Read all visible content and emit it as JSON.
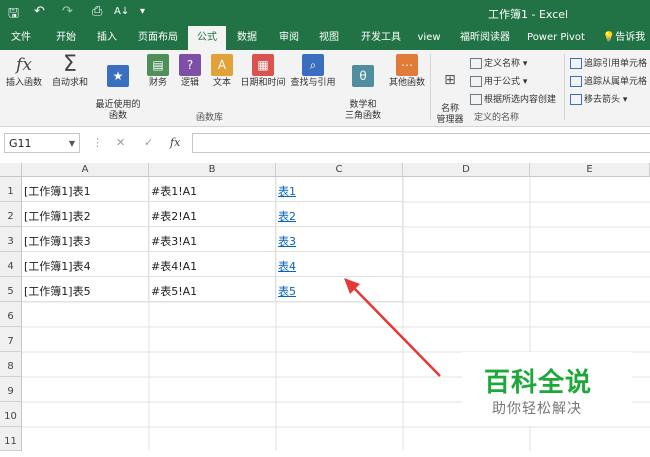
{
  "quick_access": {
    "save": "🖫",
    "undo": "↶",
    "redo": "↷",
    "print_preview": "⎙",
    "sort": "A↓",
    "more": "▾"
  },
  "window_title": "工作簿1 - Excel",
  "tabs": [
    "文件",
    "开始",
    "插入",
    "页面布局",
    "公式",
    "数据",
    "审阅",
    "视图",
    "开发工具",
    "view",
    "福昕阅读器",
    "Power Pivot",
    "告诉我"
  ],
  "tell_me_icon": "lightbulb-icon",
  "ribbon": {
    "insert_function": "插入函数",
    "autosum": "自动求和",
    "recent": "最近使用的\n函数",
    "financial": "财务",
    "logical": "逻辑",
    "text": "文本",
    "datetime": "日期和时间",
    "lookup": "查找与引用",
    "math": "数学和\n三角函数",
    "more": "其他函数",
    "group_library": "函数库",
    "name_manager": "名称\n管理器",
    "define_name": "定义名称",
    "use_in_formula": "用于公式",
    "create_from_selection": "根据所选内容创建",
    "group_names": "定义的名称",
    "trace_precedents": "追踪引用单元格",
    "trace_dependents": "追踪从属单元格",
    "remove_arrows": "移去箭头"
  },
  "formula_bar": {
    "name_box": "G11",
    "cancel": "✕",
    "enter": "✓",
    "fx": "fx",
    "value": ""
  },
  "columns": [
    "A",
    "B",
    "C",
    "D",
    "E"
  ],
  "rows": [
    "1",
    "2",
    "3",
    "4",
    "5",
    "6",
    "7",
    "8",
    "9",
    "10",
    "11"
  ],
  "cells": [
    [
      "[工作簿1]表1",
      "#表1!A1",
      "表1"
    ],
    [
      "[工作簿1]表2",
      "#表2!A1",
      "表2"
    ],
    [
      "[工作簿1]表3",
      "#表3!A1",
      "表3"
    ],
    [
      "[工作簿1]表4",
      "#表4!A1",
      "表4"
    ],
    [
      "[工作簿1]表5",
      "#表5!A1",
      "表5"
    ]
  ],
  "watermark": {
    "title": "百科全说",
    "subtitle": "助你轻松解决"
  },
  "colors": {
    "excel_green": "#217346",
    "link": "#0563c1",
    "arrow": "#e53935",
    "watermark": "#1fa83a"
  }
}
